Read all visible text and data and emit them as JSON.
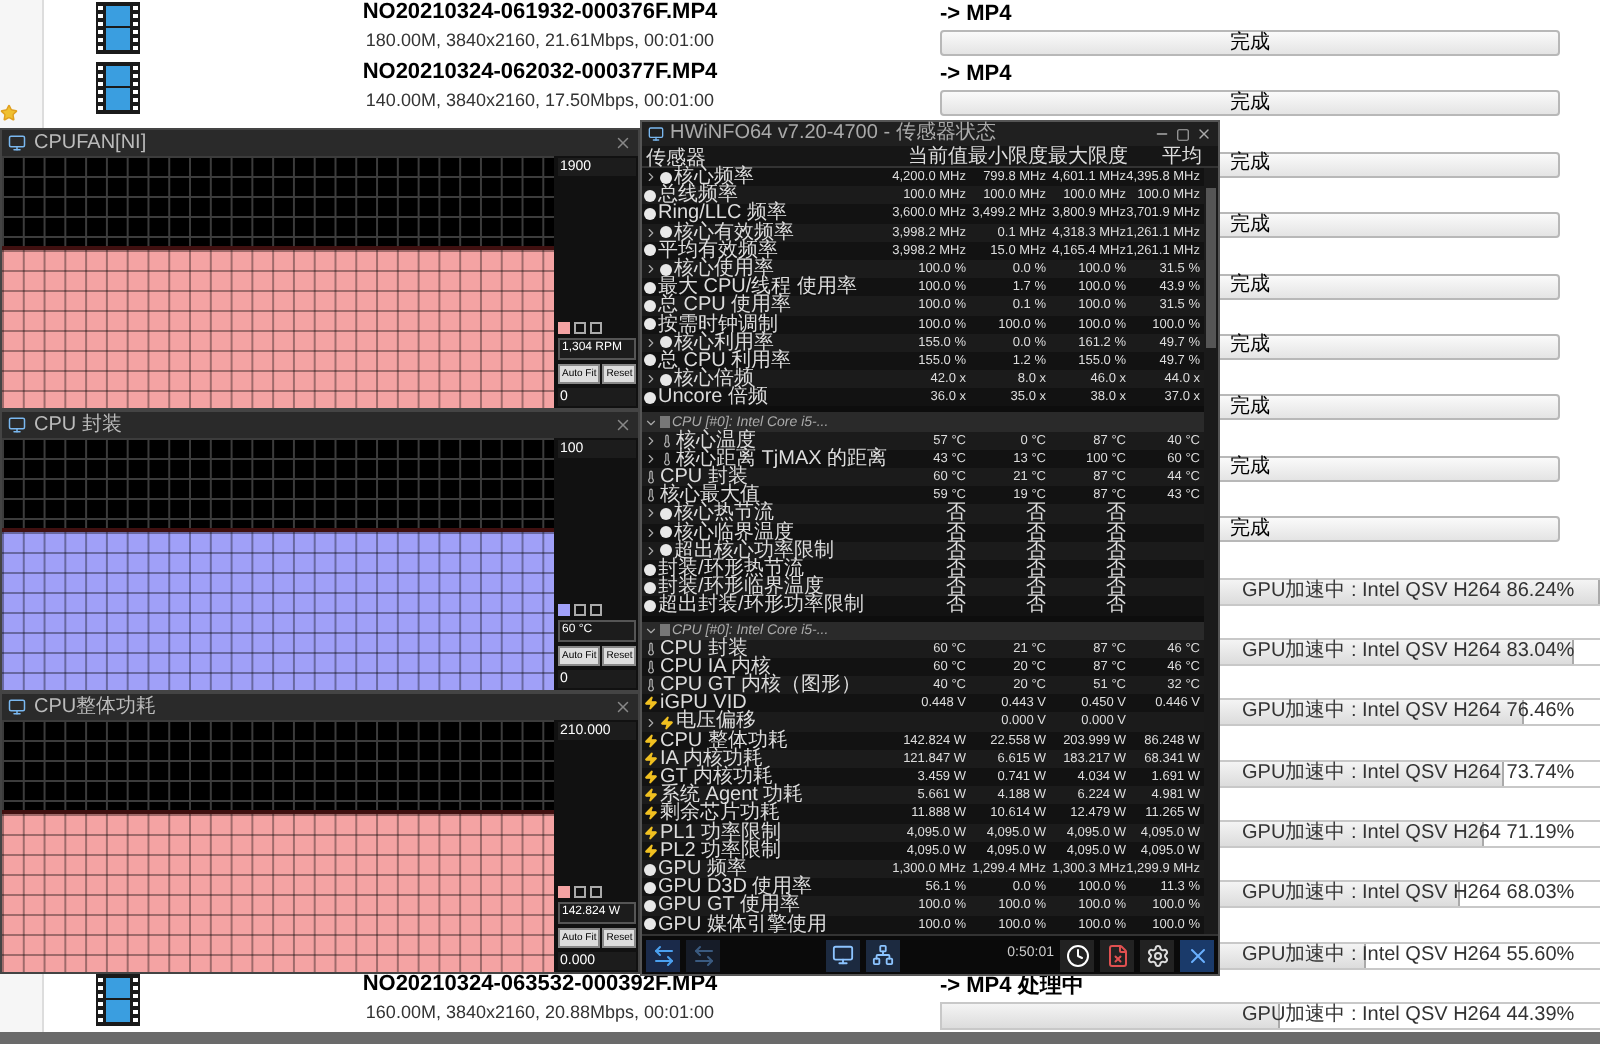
{
  "file_list": {
    "rows": [
      {
        "name": "NO20210324-061932-000376F.MP4",
        "meta": "180.00M, 3840x2160, 21.61Mbps, 00:01:00",
        "target": "-> MP4",
        "status": {
          "kind": "button",
          "label": "完成"
        }
      },
      {
        "name": "NO20210324-062032-000377F.MP4",
        "meta": "140.00M, 3840x2160, 17.50Mbps, 00:01:00",
        "target": "-> MP4",
        "status": {
          "kind": "button",
          "label": "完成"
        }
      },
      {
        "status": {
          "kind": "button",
          "label": "完成"
        }
      },
      {
        "status": {
          "kind": "button",
          "label": "完成"
        }
      },
      {
        "status": {
          "kind": "button",
          "label": "完成"
        }
      },
      {
        "status": {
          "kind": "button",
          "label": "完成"
        }
      },
      {
        "status": {
          "kind": "button",
          "label": "完成"
        }
      },
      {
        "status": {
          "kind": "button",
          "label": "完成"
        }
      },
      {
        "status": {
          "kind": "button",
          "label": "完成"
        }
      },
      {
        "status": {
          "kind": "progress",
          "label": "GPU加速中 : Intel QSV H264 86.24%",
          "level": 0.8624
        }
      },
      {
        "status": {
          "kind": "progress",
          "label": "GPU加速中 : Intel QSV H264 83.04%",
          "level": 0.8304
        }
      },
      {
        "status": {
          "kind": "progress",
          "label": "GPU加速中 : Intel QSV H264 76.46%",
          "level": 0.7646
        }
      },
      {
        "status": {
          "kind": "progress",
          "label": "GPU加速中 : Intel QSV H264 73.74%",
          "level": 0.7374
        }
      },
      {
        "status": {
          "kind": "progress",
          "label": "GPU加速中 : Intel QSV H264 71.19%",
          "level": 0.7119
        }
      },
      {
        "status": {
          "kind": "progress",
          "label": "GPU加速中 : Intel QSV H264 68.03%",
          "level": 0.6803
        }
      },
      {
        "status": {
          "kind": "progress",
          "label": "GPU加速中 : Intel QSV H264 55.60%",
          "level": 0.556
        }
      },
      {
        "name": "NO20210324-063532-000392F.MP4",
        "meta": "160.00M, 3840x2160, 20.88Mbps, 00:01:00",
        "target": "-> MP4 处理中",
        "status": {
          "kind": "progress",
          "label": "GPU加速中 : Intel QSV H264 44.39%",
          "level": 0.4439
        }
      }
    ]
  },
  "graph_windows": [
    {
      "title": "CPUFAN[NI]",
      "max": "1900",
      "reading": "1,304 RPM",
      "min": "0",
      "color": "#f4a3a3",
      "buttons": [
        "Auto Fit",
        "Reset"
      ]
    },
    {
      "title": "CPU 封装",
      "max": "100",
      "reading": "60 °C",
      "min": "0",
      "color": "#a0a0f8",
      "buttons": [
        "Auto Fit",
        "Reset"
      ]
    },
    {
      "title": "CPU整体功耗",
      "max": "210.000",
      "reading": "142.824 W",
      "min": "0.000",
      "color": "#f4a3a3",
      "buttons": [
        "Auto Fit",
        "Reset"
      ]
    }
  ],
  "hwinfo": {
    "title": "HWiNFO64 v7.20-4700 - 传感器状态",
    "columns": [
      "传感器",
      "当前值",
      "最小限度",
      "最大限度",
      "平均"
    ],
    "sections": [
      {
        "rows": [
          {
            "kind": "clock",
            "expandable": true,
            "name": "核心频率",
            "values": [
              "4,200.0 MHz",
              "799.8 MHz",
              "4,601.1 MHz",
              "4,395.8 MHz"
            ]
          },
          {
            "kind": "clock",
            "expandable": false,
            "name": "总线频率",
            "values": [
              "100.0 MHz",
              "100.0 MHz",
              "100.0 MHz",
              "100.0 MHz"
            ]
          },
          {
            "kind": "clock",
            "expandable": false,
            "name": "Ring/LLC 频率",
            "values": [
              "3,600.0 MHz",
              "3,499.2 MHz",
              "3,800.9 MHz",
              "3,701.9 MHz"
            ]
          },
          {
            "kind": "clock",
            "expandable": true,
            "name": "核心有效频率",
            "values": [
              "3,998.2 MHz",
              "0.1 MHz",
              "4,318.3 MHz",
              "1,261.1 MHz"
            ]
          },
          {
            "kind": "clock",
            "expandable": false,
            "name": "平均有效频率",
            "values": [
              "3,998.2 MHz",
              "15.0 MHz",
              "4,165.4 MHz",
              "1,261.1 MHz"
            ]
          },
          {
            "kind": "clock",
            "expandable": true,
            "name": "核心使用率",
            "values": [
              "100.0 %",
              "0.0 %",
              "100.0 %",
              "31.5 %"
            ]
          },
          {
            "kind": "clock",
            "expandable": false,
            "name": "最大 CPU/线程 使用率",
            "values": [
              "100.0 %",
              "1.7 %",
              "100.0 %",
              "43.9 %"
            ]
          },
          {
            "kind": "clock",
            "expandable": false,
            "name": "总 CPU 使用率",
            "values": [
              "100.0 %",
              "0.1 %",
              "100.0 %",
              "31.5 %"
            ]
          },
          {
            "kind": "clock",
            "expandable": false,
            "name": "按需时钟调制",
            "values": [
              "100.0 %",
              "100.0 %",
              "100.0 %",
              "100.0 %"
            ]
          },
          {
            "kind": "clock",
            "expandable": true,
            "name": "核心利用率",
            "values": [
              "155.0 %",
              "0.0 %",
              "161.2 %",
              "49.7 %"
            ]
          },
          {
            "kind": "clock",
            "expandable": false,
            "name": "总 CPU 利用率",
            "values": [
              "155.0 %",
              "1.2 %",
              "155.0 %",
              "49.7 %"
            ]
          },
          {
            "kind": "clock",
            "expandable": true,
            "name": "核心倍频",
            "values": [
              "42.0 x",
              "8.0 x",
              "46.0 x",
              "44.0 x"
            ]
          },
          {
            "kind": "clock",
            "expandable": false,
            "name": "Uncore 倍频",
            "values": [
              "36.0 x",
              "35.0 x",
              "38.0 x",
              "37.0 x"
            ]
          }
        ]
      },
      {
        "header": "CPU [#0]: Intel Core i5-...",
        "expanded": true,
        "rows": [
          {
            "kind": "temp",
            "expandable": true,
            "name": "核心温度",
            "values": [
              "57 °C",
              "0 °C",
              "87 °C",
              "40 °C"
            ]
          },
          {
            "kind": "temp",
            "expandable": true,
            "name": "核心距离 TjMAX 的距离",
            "values": [
              "43 °C",
              "13 °C",
              "100 °C",
              "60 °C"
            ]
          },
          {
            "kind": "temp",
            "expandable": false,
            "name": "CPU 封装",
            "values": [
              "60 °C",
              "21 °C",
              "87 °C",
              "44 °C"
            ]
          },
          {
            "kind": "temp",
            "expandable": false,
            "name": "核心最大值",
            "values": [
              "59 °C",
              "19 °C",
              "87 °C",
              "43 °C"
            ]
          },
          {
            "kind": "clock",
            "expandable": true,
            "name": "核心热节流",
            "values": [
              "否",
              "否",
              "否"
            ]
          },
          {
            "kind": "clock",
            "expandable": true,
            "name": "核心临界温度",
            "values": [
              "否",
              "否",
              "否"
            ]
          },
          {
            "kind": "clock",
            "expandable": true,
            "name": "超出核心功率限制",
            "values": [
              "否",
              "否",
              "否"
            ]
          },
          {
            "kind": "clock",
            "expandable": false,
            "name": "封装/环形热节流",
            "values": [
              "否",
              "否",
              "否"
            ]
          },
          {
            "kind": "clock",
            "expandable": false,
            "name": "封装/环形临界温度",
            "values": [
              "否",
              "否",
              "否"
            ]
          },
          {
            "kind": "clock",
            "expandable": false,
            "name": "超出封装/环形功率限制",
            "values": [
              "否",
              "否",
              "否"
            ]
          }
        ]
      },
      {
        "header": "CPU [#0]: Intel Core i5-...",
        "expanded": true,
        "rows": [
          {
            "kind": "temp",
            "expandable": false,
            "name": "CPU 封装",
            "values": [
              "60 °C",
              "21 °C",
              "87 °C",
              "46 °C"
            ]
          },
          {
            "kind": "temp",
            "expandable": false,
            "name": "CPU IA 内核",
            "values": [
              "60 °C",
              "20 °C",
              "87 °C",
              "46 °C"
            ]
          },
          {
            "kind": "temp",
            "expandable": false,
            "name": "CPU GT 内核（图形）",
            "values": [
              "40 °C",
              "20 °C",
              "51 °C",
              "32 °C"
            ]
          },
          {
            "kind": "volt",
            "expandable": false,
            "name": "iGPU VID",
            "values": [
              "0.448 V",
              "0.443 V",
              "0.450 V",
              "0.446 V"
            ]
          },
          {
            "kind": "volt",
            "expandable": true,
            "name": "电压偏移",
            "values": {
              "min": "0.000 V",
              "max": "0.000 V"
            }
          },
          {
            "kind": "volt",
            "expandable": false,
            "name": "CPU 整体功耗",
            "values": [
              "142.824 W",
              "22.558 W",
              "203.999 W",
              "86.248 W"
            ]
          },
          {
            "kind": "volt",
            "expandable": false,
            "name": "IA 内核功耗",
            "values": [
              "121.847 W",
              "6.615 W",
              "183.217 W",
              "68.341 W"
            ]
          },
          {
            "kind": "volt",
            "expandable": false,
            "name": "GT 内核功耗",
            "values": [
              "3.459 W",
              "0.741 W",
              "4.034 W",
              "1.691 W"
            ]
          },
          {
            "kind": "volt",
            "expandable": false,
            "name": "系统 Agent 功耗",
            "values": [
              "5.661 W",
              "4.188 W",
              "6.224 W",
              "4.981 W"
            ]
          },
          {
            "kind": "volt",
            "expandable": false,
            "name": "剩余芯片功耗",
            "values": [
              "11.888 W",
              "10.614 W",
              "12.479 W",
              "11.265 W"
            ]
          },
          {
            "kind": "volt",
            "expandable": false,
            "name": "PL1 功率限制",
            "values": [
              "4,095.0 W",
              "4,095.0 W",
              "4,095.0 W",
              "4,095.0 W"
            ]
          },
          {
            "kind": "volt",
            "expandable": false,
            "name": "PL2 功率限制",
            "values": [
              "4,095.0 W",
              "4,095.0 W",
              "4,095.0 W",
              "4,095.0 W"
            ]
          },
          {
            "kind": "clock",
            "expandable": false,
            "name": "GPU 频率",
            "values": [
              "1,300.0 MHz",
              "1,299.4 MHz",
              "1,300.3 MHz",
              "1,299.9 MHz"
            ]
          },
          {
            "kind": "clock",
            "expandable": false,
            "name": "GPU D3D 使用率",
            "values": [
              "56.1 %",
              "0.0 %",
              "100.0 %",
              "11.3 %"
            ]
          },
          {
            "kind": "clock",
            "expandable": false,
            "name": "GPU GT 使用率",
            "values": [
              "100.0 %",
              "100.0 %",
              "100.0 %",
              "100.0 %"
            ]
          },
          {
            "kind": "clock",
            "expandable": false,
            "name": "GPU 媒体引擎使用",
            "values": [
              "100.0 %",
              "100.0 %",
              "100.0 %",
              "100.0 %"
            ]
          }
        ]
      }
    ],
    "timer": "0:50:01"
  }
}
